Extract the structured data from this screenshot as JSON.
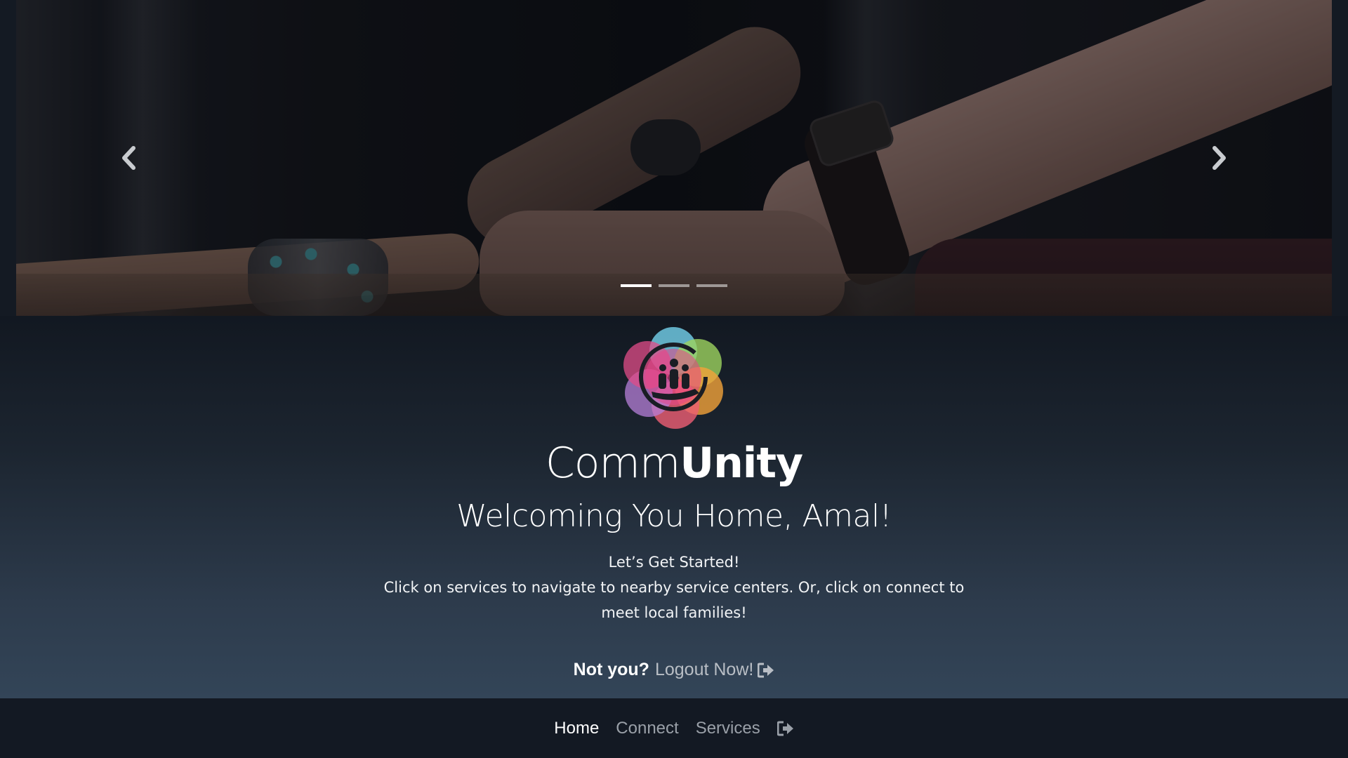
{
  "carousel": {
    "slides": 3,
    "active_index": 0,
    "prev_icon": "chevron-left-icon",
    "next_icon": "chevron-right-icon"
  },
  "hero": {
    "logo_icon": "community-logo-icon",
    "brand_light": "Comm",
    "brand_bold": "Unity",
    "welcome": "Welcoming You Home, Amal!",
    "intro_line1": "Let’s Get Started!",
    "intro_line2": "Click on services to navigate to nearby service centers. Or, click on connect to meet local families!",
    "not_you": "Not you?",
    "logout_label": "Logout Now!",
    "logout_icon": "sign-out-icon"
  },
  "nav": {
    "items": [
      {
        "label": "Home",
        "active": true
      },
      {
        "label": "Connect",
        "active": false
      },
      {
        "label": "Services",
        "active": false
      }
    ],
    "logout_icon": "sign-out-icon"
  },
  "colors": {
    "background_dark": "#131923",
    "hero_gradient_bottom": "#334558",
    "link_muted": "#b9bec5",
    "text": "#ffffff"
  }
}
